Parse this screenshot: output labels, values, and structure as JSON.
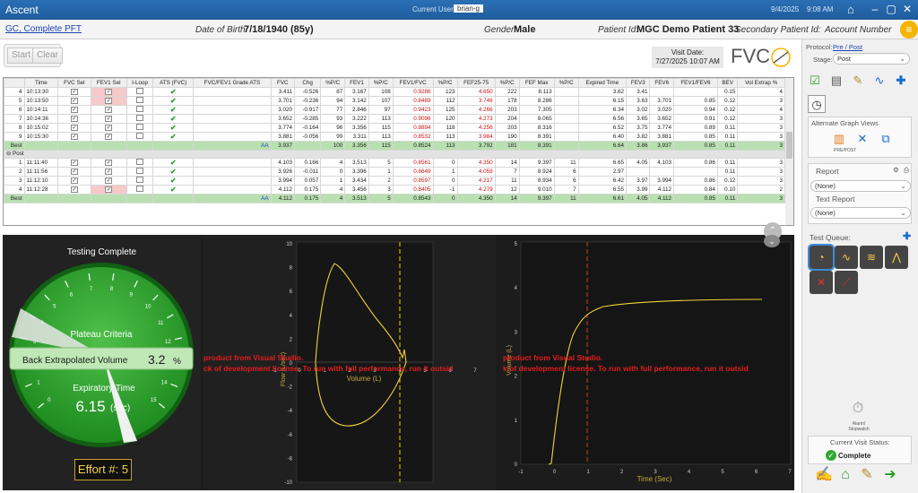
{
  "titlebar": {
    "app": "Ascent",
    "current_user_label": "Current User:",
    "current_user": "brian-g",
    "date": "9/4/2025",
    "time": "9:08 AM"
  },
  "patient": {
    "test_link": "GC, Complete PFT",
    "dob_label": "Date of Birth:",
    "dob": "7/18/1940 (85y)",
    "gender_label": "Gender:",
    "gender": "Male",
    "pid_label": "Patient Id:",
    "pid": "MGC Demo Patient 33",
    "secondary_label": "Secondary Patient Id:",
    "account_label": "Account Number"
  },
  "toolbar": {
    "start": "Start",
    "clear": "Clear",
    "visit_label": "Visit Date:",
    "visit_date": "7/27/2025 10:07 AM",
    "fvc_logo": "FVC"
  },
  "table": {
    "headers": [
      "",
      "Time",
      "FVC Sel",
      "FEV1 Sel",
      "I-Loop",
      "ATS (FVC)",
      "FVC/FEV1 Grade ATS",
      "FVC",
      "Chg",
      "%P/C",
      "FEV1",
      "%P/C",
      "FEV1/FVC",
      "%P/C",
      "FEF25-75",
      "%P/C",
      "FEF Max",
      "%P/C",
      "Expired Time",
      "FEV3",
      "FEV6",
      "FEV1/FEV6",
      "BEV",
      "Vol Extrap %"
    ],
    "pre_rows": [
      [
        "4",
        "10:13:30",
        "",
        "",
        "",
        "",
        "",
        "3.411",
        "-0.526",
        "87",
        "3.167",
        "108",
        "0.9286",
        "123",
        "4.650",
        "222",
        "8.113",
        "",
        "3.62",
        "3.41",
        "",
        "",
        "0.15",
        "4"
      ],
      [
        "5",
        "10:13:50",
        "",
        "",
        "",
        "",
        "",
        "3.701",
        "-0.236",
        "94",
        "3.142",
        "107",
        "0.8489",
        "112",
        "3.746",
        "178",
        "8.286",
        "",
        "6.15",
        "3.63",
        "3.701",
        "0.85",
        "0.12",
        "3"
      ],
      [
        "6",
        "10:14:11",
        "",
        "",
        "",
        "",
        "",
        "3.020",
        "-0.917",
        "77",
        "2.846",
        "97",
        "0.9423",
        "125",
        "4.266",
        "203",
        "7.305",
        "",
        "6.34",
        "3.02",
        "3.020",
        "0.94",
        "0.12",
        "4"
      ],
      [
        "7",
        "10:14:36",
        "",
        "",
        "",
        "",
        "",
        "3.652",
        "-0.285",
        "93",
        "3.222",
        "113",
        "0.9096",
        "120",
        "4.273",
        "204",
        "8.065",
        "",
        "6.56",
        "3.65",
        "3.652",
        "0.91",
        "0.12",
        "3"
      ],
      [
        "8",
        "10:15:02",
        "",
        "",
        "",
        "",
        "",
        "3.774",
        "-0.164",
        "96",
        "3.356",
        "115",
        "0.8894",
        "118",
        "4.256",
        "203",
        "8.316",
        "",
        "6.52",
        "3.75",
        "3.774",
        "0.89",
        "0.11",
        "3"
      ],
      [
        "9",
        "10:15:30",
        "",
        "",
        "",
        "",
        "",
        "3.881",
        "-0.056",
        "99",
        "3.311",
        "113",
        "0.8532",
        "113",
        "3.984",
        "190",
        "8.391",
        "",
        "6.40",
        "3.82",
        "3.881",
        "0.85",
        "0.11",
        "3"
      ]
    ],
    "pre_best": [
      "Best",
      "",
      "",
      "",
      "",
      "",
      "AA",
      "3.937",
      "",
      "100",
      "3.356",
      "115",
      "0.8524",
      "113",
      "3.792",
      "181",
      "8.391",
      "",
      "6.64",
      "3.86",
      "3.937",
      "0.85",
      "0.11",
      "3"
    ],
    "post_label": "Post",
    "post_rows": [
      [
        "1",
        "11:11:40",
        "",
        "",
        "",
        "",
        "",
        "4.103",
        "0.166",
        "4",
        "3.513",
        "5",
        "0.8561",
        "0",
        "4.350",
        "14",
        "9.397",
        "11",
        "6.65",
        "4.05",
        "4.103",
        "0.86",
        "0.11",
        "3"
      ],
      [
        "2",
        "11:11:56",
        "",
        "",
        "",
        "",
        "",
        "3.926",
        "-0.011",
        "0",
        "3.396",
        "1",
        "0.8649",
        "1",
        "4.059",
        "7",
        "8.924",
        "6",
        "2.97",
        "",
        "",
        "",
        "0.11",
        "3"
      ],
      [
        "3",
        "11:12:10",
        "",
        "",
        "",
        "",
        "",
        "3.994",
        "0.057",
        "1",
        "3.434",
        "2",
        "0.8597",
        "0",
        "4.217",
        "11",
        "8.934",
        "6",
        "6.42",
        "3.97",
        "3.994",
        "0.86",
        "0.12",
        "3"
      ],
      [
        "4",
        "11:12:28",
        "",
        "",
        "",
        "",
        "",
        "4.112",
        "0.175",
        "4",
        "3.456",
        "3",
        "0.8405",
        "-1",
        "4.279",
        "12",
        "9.010",
        "7",
        "6.55",
        "3.99",
        "4.112",
        "0.84",
        "0.10",
        "2"
      ]
    ],
    "post_best": [
      "Best",
      "",
      "",
      "",
      "",
      "",
      "AA",
      "4.112",
      "0.175",
      "4",
      "3.513",
      "5",
      "0.8543",
      "0",
      "4.350",
      "14",
      "9.397",
      "11",
      "6.61",
      "4.05",
      "4.112",
      "0.85",
      "0.11",
      "3"
    ]
  },
  "gauge": {
    "title": "Testing Complete",
    "plateau": "Plateau Criteria",
    "bev_label": "Back Extrapolated Volume",
    "bev_value": "3.2",
    "bev_unit": "%",
    "exp_label": "Expiratory Time",
    "exp_value": "6.15",
    "exp_unit": "(sec)",
    "ticks": [
      "0",
      "1",
      "2",
      "3",
      "4",
      "5",
      "6",
      "7",
      "8",
      "9",
      "10",
      "11",
      "12",
      "13",
      "14",
      "15"
    ],
    "effort": "Effort #: 5"
  },
  "flow_volume": {
    "y_label": "Flow (L/sec)",
    "x_label": "Volume (L)",
    "y_ticks": [
      "10",
      "8",
      "6",
      "4",
      "2",
      "0",
      "-2",
      "-4",
      "-6",
      "-8",
      "-10"
    ],
    "x_ticks": [
      "-1",
      "0",
      "1",
      "2",
      "3",
      "4",
      "5",
      "6",
      "7"
    ]
  },
  "volume_time": {
    "y_label": "Volume (L)",
    "x_label": "Time (Sec)",
    "y_ticks": [
      "5",
      "4",
      "3",
      "2",
      "1",
      "0"
    ],
    "x_ticks": [
      "-1",
      "0",
      "1",
      "2",
      "3",
      "4",
      "5",
      "6",
      "7"
    ]
  },
  "watermark": {
    "line1": "product from Visual Studio.",
    "line2": "ck of development license. To run with full performance, run it outsid",
    "line1b": "product from Visual Studio.",
    "line2b": "k of development license. To run with full performance, run it outsid"
  },
  "sidebar": {
    "protocol_label": "Protocol:",
    "protocol": "Pre / Post",
    "stage_label": "Stage:",
    "stage": "Post",
    "alt_graph": "Alternate Graph Views",
    "alt_caption": "PRE/POST",
    "report_label": "Report",
    "report_value": "(None)",
    "text_report_label": "Text Report",
    "text_report_value": "(None)",
    "test_queue": "Test Queue:",
    "alarm": "Alarm/ Stopwatch",
    "visit_status_label": "Current Visit Status:",
    "visit_status": "Complete"
  }
}
